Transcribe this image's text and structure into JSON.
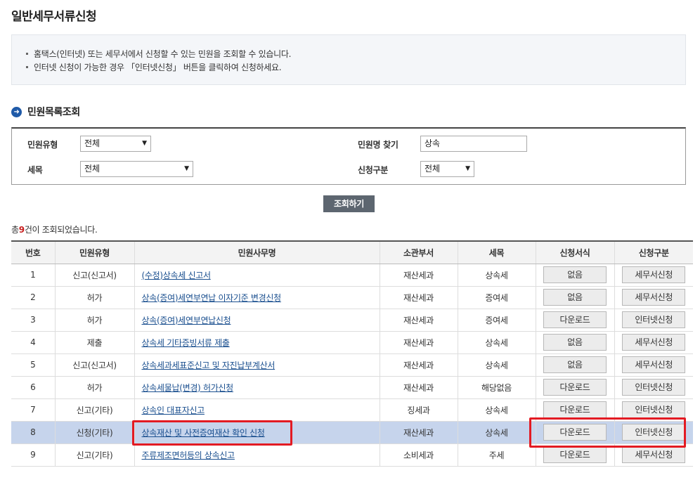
{
  "page": {
    "title": "일반세무서류신청"
  },
  "info": {
    "lines": [
      "홈택스(인터넷) 또는 세무서에서 신청할 수 있는 민원을 조회할 수 있습니다.",
      "인터넷 신청이 가능한 경우 「인터넷신청」 버튼을 클릭하여 신청하세요."
    ]
  },
  "section": {
    "title": "민원목록조회"
  },
  "search": {
    "type_label": "민원유형",
    "type_value": "전체",
    "tax_label": "세목",
    "tax_value": "전체",
    "name_label": "민원명 찾기",
    "name_value": "상속",
    "apply_label": "신청구분",
    "apply_value": "전체",
    "button": "조회하기"
  },
  "result": {
    "prefix": "총",
    "count": "9",
    "suffix": "건이 조회되었습니다."
  },
  "table": {
    "headers": [
      "번호",
      "민원유형",
      "민원사무명",
      "소관부서",
      "세목",
      "신청서식",
      "신청구분"
    ],
    "rows": [
      {
        "no": "1",
        "type": "신고(신고서)",
        "name": "(수정)상속세 신고서",
        "dept": "재산세과",
        "tax": "상속세",
        "form": "없음",
        "apply": "세무서신청"
      },
      {
        "no": "2",
        "type": "허가",
        "name": "상속(증여)세연부연납 이자기준 변경신청",
        "dept": "재산세과",
        "tax": "증여세",
        "form": "없음",
        "apply": "세무서신청"
      },
      {
        "no": "3",
        "type": "허가",
        "name": "상속(증여)세연부연납신청",
        "dept": "재산세과",
        "tax": "증여세",
        "form": "다운로드",
        "apply": "인터넷신청"
      },
      {
        "no": "4",
        "type": "제출",
        "name": "상속세 기타증빙서류 제출",
        "dept": "재산세과",
        "tax": "상속세",
        "form": "없음",
        "apply": "세무서신청"
      },
      {
        "no": "5",
        "type": "신고(신고서)",
        "name": "상속세과세표준신고 및 자진납부계산서",
        "dept": "재산세과",
        "tax": "상속세",
        "form": "없음",
        "apply": "세무서신청"
      },
      {
        "no": "6",
        "type": "허가",
        "name": "상속세물납(변경) 허가신청",
        "dept": "재산세과",
        "tax": "해당없음",
        "form": "다운로드",
        "apply": "인터넷신청"
      },
      {
        "no": "7",
        "type": "신고(기타)",
        "name": "상속인 대표자신고",
        "dept": "징세과",
        "tax": "상속세",
        "form": "다운로드",
        "apply": "인터넷신청"
      },
      {
        "no": "8",
        "type": "신청(기타)",
        "name": "상속재산 및 사전증여재산 확인 신청",
        "dept": "재산세과",
        "tax": "상속세",
        "form": "다운로드",
        "apply": "인터넷신청"
      },
      {
        "no": "9",
        "type": "신고(기타)",
        "name": "주류제조면허등의 상속신고",
        "dept": "소비세과",
        "tax": "주세",
        "form": "다운로드",
        "apply": "세무서신청"
      }
    ]
  },
  "colors": {
    "highlight_row": "#c6d4ec",
    "annotation": "#e31b23",
    "link": "#1a4f8f",
    "search_button": "#5d6670"
  }
}
